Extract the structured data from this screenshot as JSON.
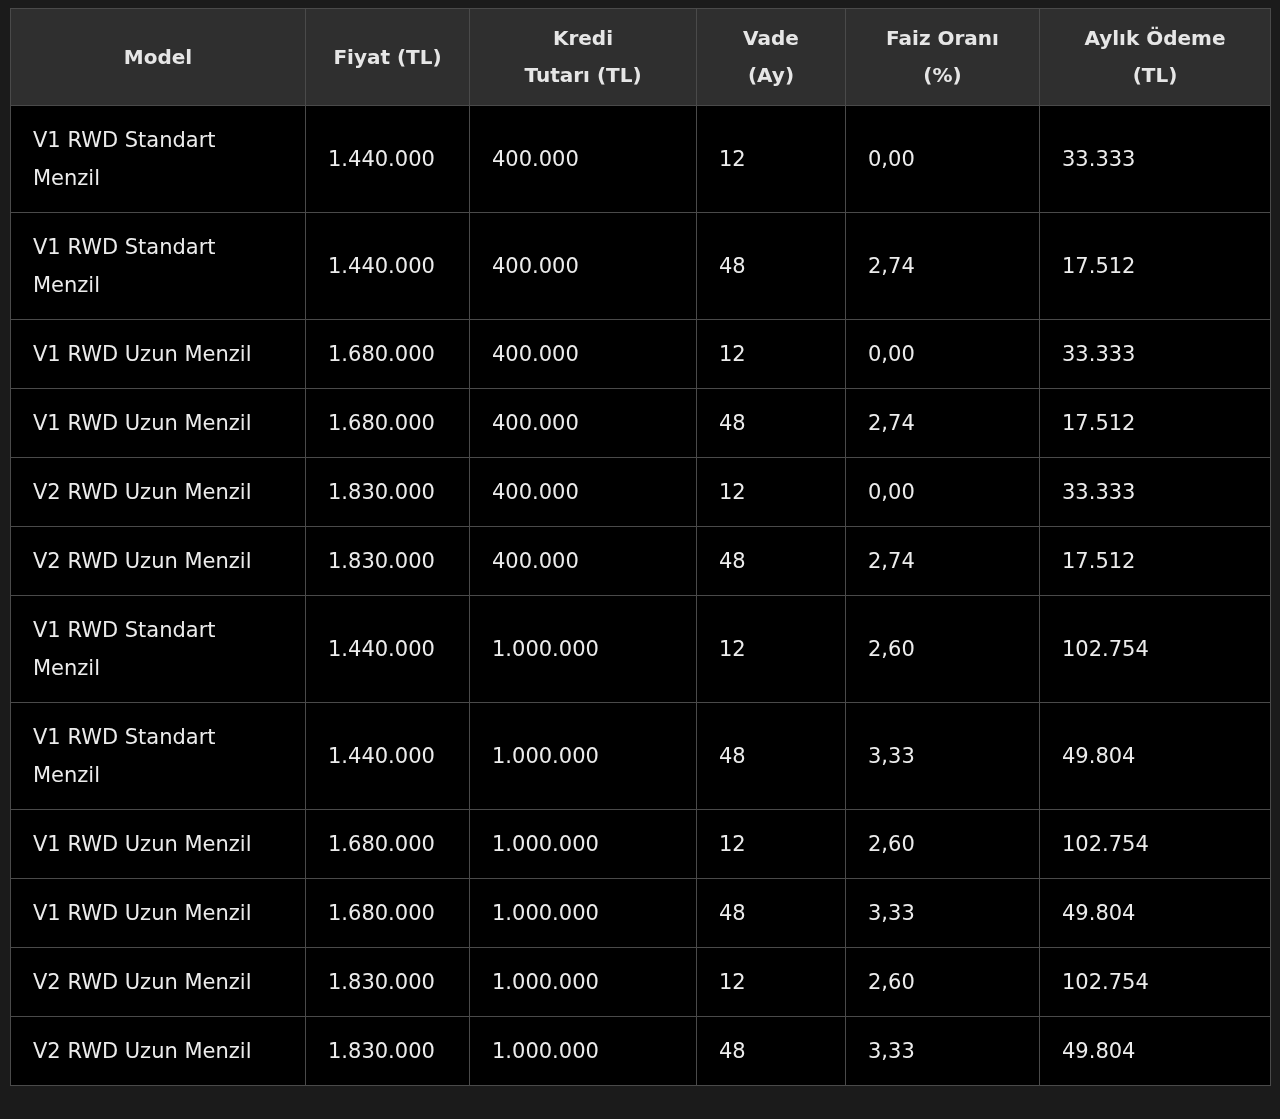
{
  "table": {
    "columns": [
      "Model",
      "Fiyat (TL)",
      "Kredi Tutarı (TL)",
      "Vade (Ay)",
      "Faiz Oranı (%)",
      "Aylık Ödeme (TL)"
    ],
    "rows": [
      [
        "V1 RWD Standart Menzil",
        "1.440.000",
        "400.000",
        "12",
        "0,00",
        "33.333"
      ],
      [
        "V1 RWD Standart Menzil",
        "1.440.000",
        "400.000",
        "48",
        "2,74",
        "17.512"
      ],
      [
        "V1 RWD Uzun Menzil",
        "1.680.000",
        "400.000",
        "12",
        "0,00",
        "33.333"
      ],
      [
        "V1 RWD Uzun Menzil",
        "1.680.000",
        "400.000",
        "48",
        "2,74",
        "17.512"
      ],
      [
        "V2 RWD Uzun Menzil",
        "1.830.000",
        "400.000",
        "12",
        "0,00",
        "33.333"
      ],
      [
        "V2 RWD Uzun Menzil",
        "1.830.000",
        "400.000",
        "48",
        "2,74",
        "17.512"
      ],
      [
        "V1 RWD Standart Menzil",
        "1.440.000",
        "1.000.000",
        "12",
        "2,60",
        "102.754"
      ],
      [
        "V1 RWD Standart Menzil",
        "1.440.000",
        "1.000.000",
        "48",
        "3,33",
        "49.804"
      ],
      [
        "V1 RWD Uzun Menzil",
        "1.680.000",
        "1.000.000",
        "12",
        "2,60",
        "102.754"
      ],
      [
        "V1 RWD Uzun Menzil",
        "1.680.000",
        "1.000.000",
        "48",
        "3,33",
        "49.804"
      ],
      [
        "V2 RWD Uzun Menzil",
        "1.830.000",
        "1.000.000",
        "12",
        "2,60",
        "102.754"
      ],
      [
        "V2 RWD Uzun Menzil",
        "1.830.000",
        "1.000.000",
        "48",
        "3,33",
        "49.804"
      ]
    ]
  }
}
